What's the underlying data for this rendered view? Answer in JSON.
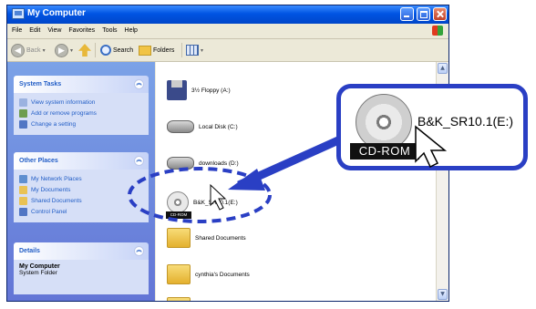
{
  "window": {
    "title": "My Computer"
  },
  "menu": [
    "File",
    "Edit",
    "View",
    "Favorites",
    "Tools",
    "Help"
  ],
  "toolbar": {
    "back": "Back",
    "search": "Search",
    "folders": "Folders"
  },
  "system_tasks": {
    "title": "System Tasks",
    "items": [
      "View system information",
      "Add or remove programs",
      "Change a setting"
    ]
  },
  "other_places": {
    "title": "Other Places",
    "items": [
      "My Network Places",
      "My Documents",
      "Shared Documents",
      "Control Panel"
    ]
  },
  "details": {
    "title": "Details",
    "name": "My Computer",
    "type": "System Folder"
  },
  "drives": [
    {
      "label": "3½ Floppy (A:)"
    },
    {
      "label": "Local Disk (C:)"
    },
    {
      "label": "downloads (D:)"
    },
    {
      "label": "B&K_SR10.1(E:)"
    }
  ],
  "folders": [
    {
      "label": "Shared Documents"
    },
    {
      "label": "cynthia's Documents"
    }
  ],
  "callout": {
    "badge": "CD-ROM",
    "drive_label": "B&K_SR10.1(E:)"
  },
  "colors": {
    "accent": "#2a3fc4",
    "titlebar": "#0054e3"
  }
}
